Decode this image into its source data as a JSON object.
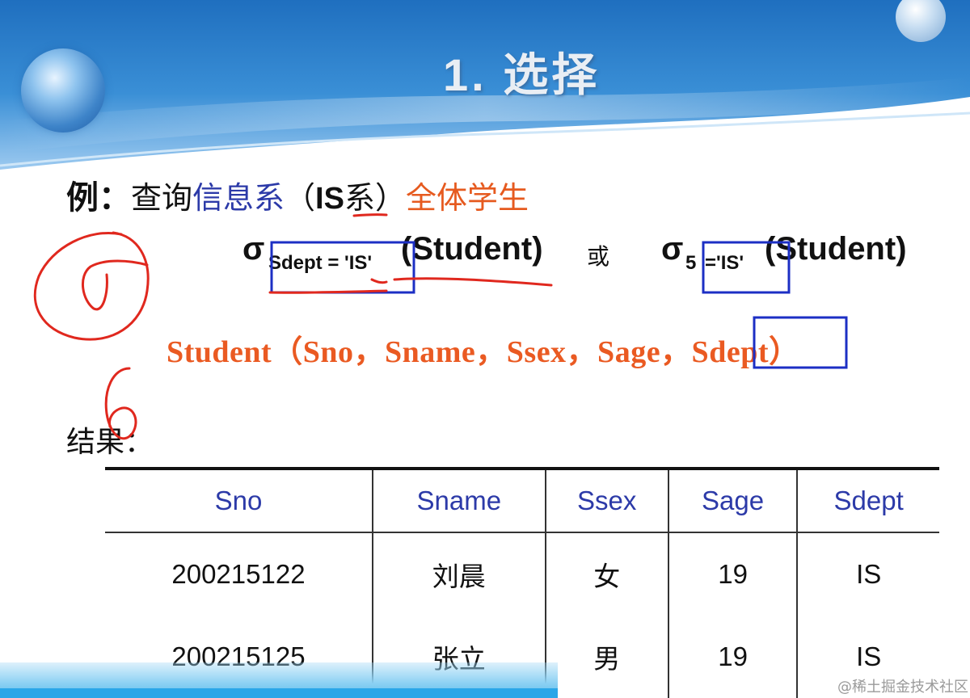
{
  "slide": {
    "title": "1.  选择",
    "example": {
      "label": "例：",
      "text_plain": "查询",
      "text_blue": "信息系",
      "paren_open": "（",
      "abbr": "IS",
      "text_after": "系）",
      "text_orange": "全体学生"
    },
    "expr1": {
      "sigma": "σ",
      "subscript": "Sdept = 'IS'",
      "relation": "(Student)"
    },
    "or_word": "或",
    "expr2": {
      "sigma": "σ",
      "subscript_index": "5",
      "subscript_value": "='IS'",
      "relation": "(Student)"
    },
    "schema": "Student（Sno，Sname，Ssex，Sage，Sdept）",
    "result_label": "结果：",
    "table": {
      "headers": [
        "Sno",
        "Sname",
        "Ssex",
        "Sage",
        "Sdept"
      ],
      "rows": [
        [
          "200215122",
          "刘晨",
          "女",
          "19",
          "IS"
        ],
        [
          "200215125",
          "张立",
          "男",
          "19",
          "IS"
        ]
      ]
    },
    "handwritten_number": "6"
  },
  "watermark": "@稀土掘金技术社区",
  "colors": {
    "header_blue": "#2f7fc8",
    "text_blue": "#2c3aa8",
    "text_orange": "#e65a1f",
    "dept_pink": "#e24fc1",
    "annotation_red": "#e0281e",
    "box_blue": "#1c2fc4"
  }
}
